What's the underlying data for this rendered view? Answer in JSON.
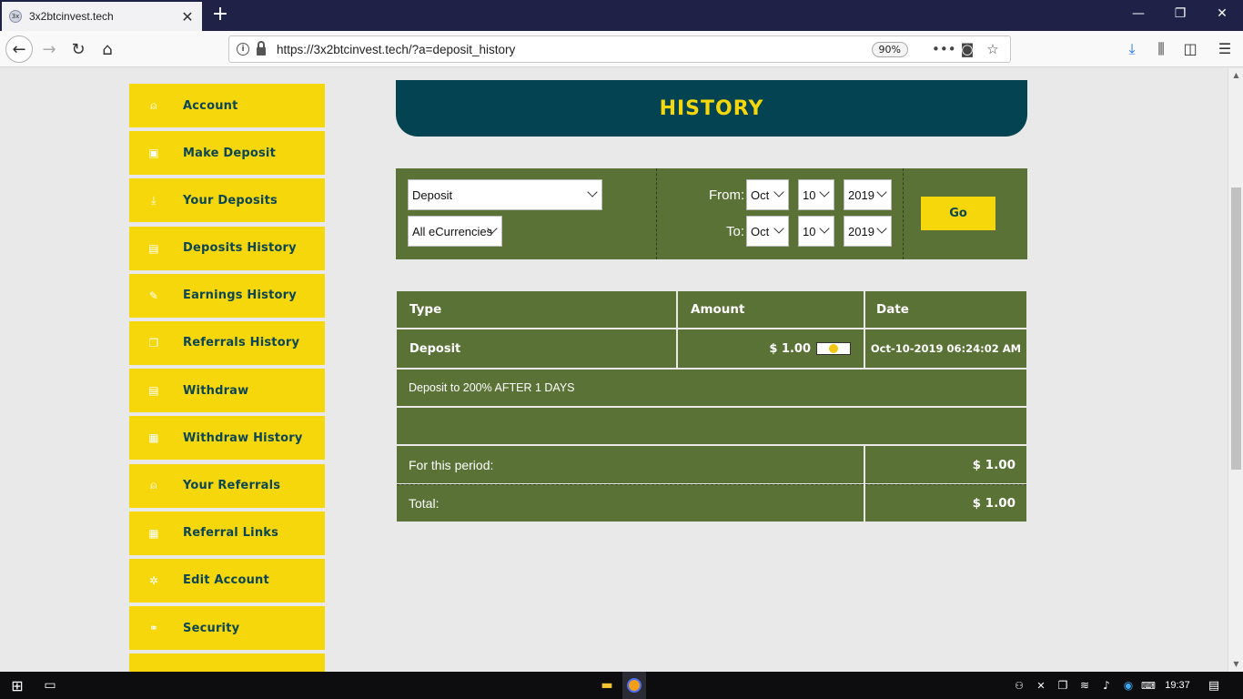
{
  "browser": {
    "tab_title": "3x2btcinvest.tech",
    "favicon_text": "3x",
    "url": "https://3x2btcinvest.tech/?a=deposit_history",
    "zoom": "90%"
  },
  "sidebar": {
    "items": [
      {
        "label": "Account",
        "icon": "user-icon"
      },
      {
        "label": "Make Deposit",
        "icon": "wallet-icon"
      },
      {
        "label": "Your Deposits",
        "icon": "download-icon"
      },
      {
        "label": "Deposits History",
        "icon": "list-icon"
      },
      {
        "label": "Earnings History",
        "icon": "edit-icon"
      },
      {
        "label": "Referrals History",
        "icon": "copy-icon"
      },
      {
        "label": "Withdraw",
        "icon": "document-icon"
      },
      {
        "label": "Withdraw History",
        "icon": "calendar-icon"
      },
      {
        "label": "Your Referrals",
        "icon": "user-icon"
      },
      {
        "label": "Referral Links",
        "icon": "grid-icon"
      },
      {
        "label": "Edit Account",
        "icon": "gear-icon"
      },
      {
        "label": "Security",
        "icon": "link-icon"
      }
    ]
  },
  "header": {
    "title": "HISTORY"
  },
  "filter": {
    "type_select": "Deposit",
    "currency_select": "All eCurrencies",
    "from_label": "From:",
    "to_label": "To:",
    "from_month": "Oct",
    "from_day": "10",
    "from_year": "2019",
    "to_month": "Oct",
    "to_day": "10",
    "to_year": "2019",
    "go_label": "Go"
  },
  "table": {
    "headers": {
      "type": "Type",
      "amount": "Amount",
      "date": "Date"
    },
    "row": {
      "type": "Deposit",
      "amount": "$ 1.00",
      "date": "Oct-10-2019 06:24:02 AM",
      "description": "Deposit to 200% AFTER 1 DAYS"
    },
    "period_label": "For this period:",
    "period_value": "$ 1.00",
    "total_label": "Total:",
    "total_value": "$ 1.00"
  },
  "taskbar": {
    "time": "19:37"
  },
  "colors": {
    "accent_yellow": "#f6d70b",
    "dark_teal": "#044452",
    "panel_green": "#5a7236",
    "page_bg": "#e9e9e9"
  }
}
